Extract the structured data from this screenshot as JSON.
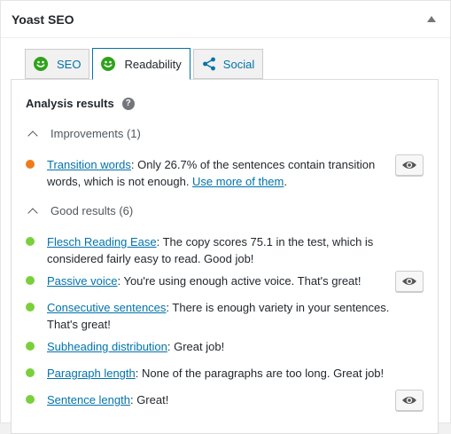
{
  "metabox": {
    "title": "Yoast SEO"
  },
  "tabs": [
    {
      "label": "SEO",
      "icon": "smiley-icon"
    },
    {
      "label": "Readability",
      "icon": "smiley-icon"
    },
    {
      "label": "Social",
      "icon": "share-icon"
    }
  ],
  "analysis": {
    "title": "Analysis results",
    "improvements": {
      "heading": "Improvements (1)",
      "items": [
        {
          "link": "Transition words",
          "text": ": Only 26.7% of the sentences contain transition words, which is not enough. ",
          "link2": "Use more of them",
          "text2": ".",
          "status_color": "#ee7c1b"
        }
      ]
    },
    "good": {
      "heading": "Good results (6)",
      "items": [
        {
          "link": "Flesch Reading Ease",
          "text": ": The copy scores 75.1 in the test, which is considered fairly easy to read. Good job!"
        },
        {
          "link": "Passive voice",
          "text": ": You're using enough active voice. That's great!"
        },
        {
          "link": "Consecutive sentences",
          "text": ": There is enough variety in your sentences. That's great!"
        },
        {
          "link": "Subheading distribution",
          "text": ": Great job!"
        },
        {
          "link": "Paragraph length",
          "text": ": None of the paragraphs are too long. Great job!"
        },
        {
          "link": "Sentence length",
          "text": ": Great!"
        }
      ],
      "status_color": "#7ad03a"
    }
  }
}
